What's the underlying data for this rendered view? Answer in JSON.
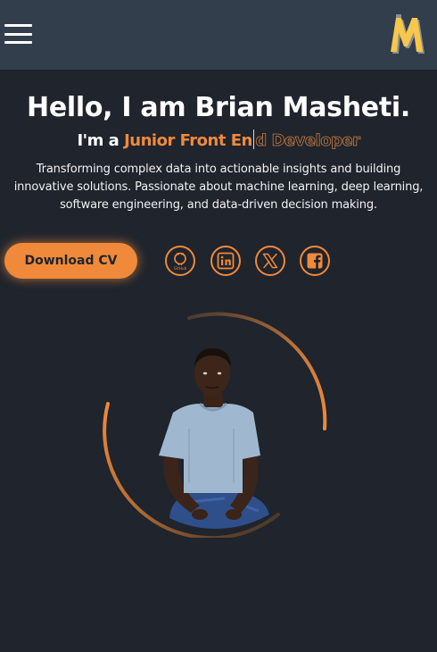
{
  "header": {
    "menu_icon": "hamburger-menu-icon",
    "logo_letter": "M",
    "logo_colors": {
      "primary": "#f6c74a",
      "shadow": "#8a8f96"
    }
  },
  "hero": {
    "greeting": "Hello, I am Brian Masheti.",
    "role_prefix": "I'm a",
    "role_typed": "Junior Front En",
    "role_rest": "d Developer",
    "description": "Transforming complex data into actionable insights and building innovative solutions. Passionate about machine learning, deep learning, software engineering, and data-driven decision making."
  },
  "actions": {
    "download_cv": "Download CV"
  },
  "social": [
    {
      "name": "github",
      "icon": "github-icon",
      "label": "GitHub"
    },
    {
      "name": "linkedin",
      "icon": "linkedin-icon"
    },
    {
      "name": "x",
      "icon": "x-icon"
    },
    {
      "name": "facebook",
      "icon": "facebook-icon"
    }
  ],
  "colors": {
    "background": "#1f242d",
    "header": "#323e4c",
    "accent": "#f08a3a",
    "text": "#ffffff"
  }
}
